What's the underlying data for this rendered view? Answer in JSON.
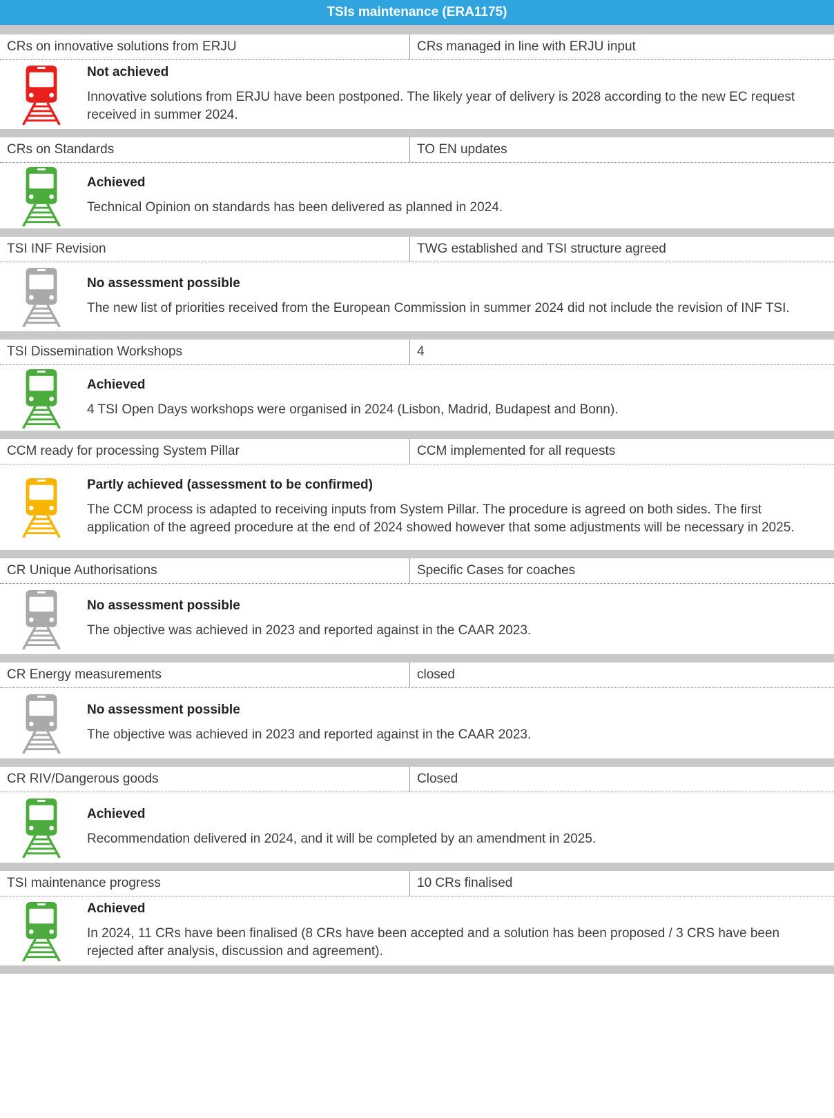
{
  "title": "TSIs maintenance (ERA1175)",
  "colors": {
    "title_bg": "#2fa4df",
    "separator": "#c8c8c8",
    "red": "#e8201c",
    "green": "#4cab3d",
    "grey": "#a9a9a9",
    "amber": "#f7b500"
  },
  "rows": [
    {
      "indicator": "CRs on innovative solutions from ERJU",
      "target": "CRs managed in line with ERJU input",
      "status_color": "red",
      "status": "Not achieved",
      "description": "Innovative solutions from ERJU have been postponed. The likely year of delivery is 2028 according to the new EC request received in summer 2024."
    },
    {
      "indicator": "CRs on Standards",
      "target": "TO EN updates",
      "status_color": "green",
      "status": "Achieved",
      "description": "Technical Opinion on standards has been delivered as planned in 2024."
    },
    {
      "indicator": "TSI INF Revision",
      "target": "TWG established and TSI structure agreed",
      "status_color": "grey",
      "status": "No assessment possible",
      "description": "The new list of priorities received from the European Commission in summer 2024 did not include the revision of INF TSI."
    },
    {
      "indicator": "TSI Dissemination Workshops",
      "target": "4",
      "status_color": "green",
      "status": "Achieved",
      "description": "4 TSI Open Days workshops were organised in 2024 (Lisbon, Madrid, Budapest and Bonn)."
    },
    {
      "indicator": "CCM ready for processing System Pillar",
      "target": "CCM implemented for all requests",
      "status_color": "amber",
      "status": "Partly achieved (assessment to be confirmed)",
      "description": "The CCM process is adapted to receiving inputs from System Pillar. The procedure is agreed on both sides. The first application of the agreed procedure at the end of 2024 showed however that some adjustments will be necessary in 2025."
    },
    {
      "indicator": "CR Unique Authorisations",
      "target": "Specific Cases for coaches",
      "status_color": "grey",
      "status": "No assessment possible",
      "description": "The objective was achieved in 2023 and reported against in the CAAR 2023."
    },
    {
      "indicator": "CR Energy measurements",
      "target": "closed",
      "status_color": "grey",
      "status": "No assessment possible",
      "description": "The objective was achieved in 2023 and reported against in the CAAR 2023."
    },
    {
      "indicator": "CR RIV/Dangerous goods",
      "target": "Closed",
      "status_color": "green",
      "status": "Achieved",
      "description": "Recommendation delivered in 2024, and it will be completed by an amendment in 2025."
    },
    {
      "indicator": "TSI maintenance progress",
      "target": "10 CRs finalised",
      "status_color": "green",
      "status": "Achieved",
      "description": "In 2024, 11 CRs have been finalised (8 CRs have been accepted and a solution has been proposed / 3 CRS have been rejected after analysis, discussion and agreement)."
    }
  ]
}
